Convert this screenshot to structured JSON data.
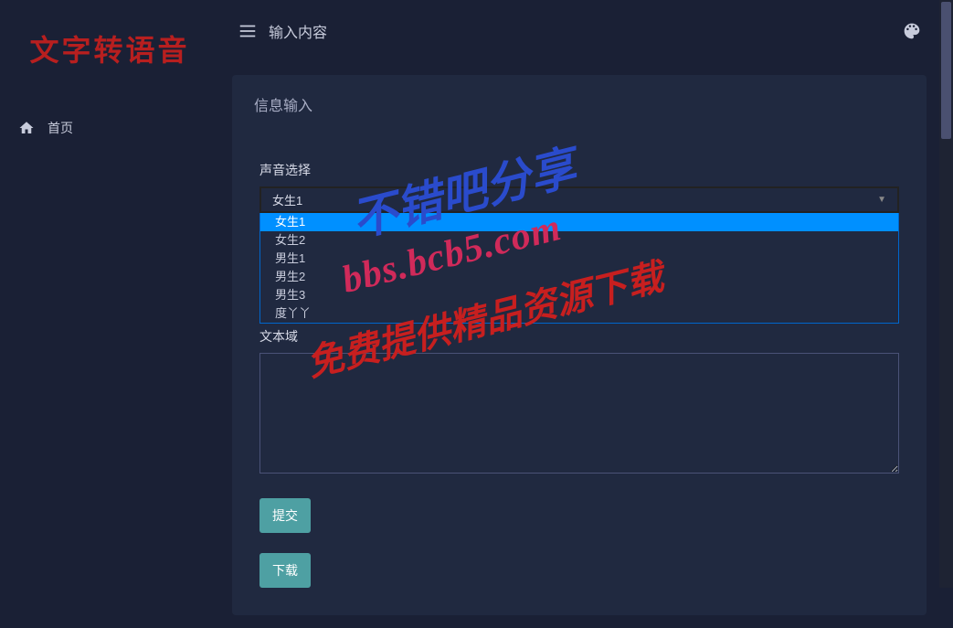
{
  "app": {
    "logo_text": "文字转语音"
  },
  "sidebar": {
    "items": [
      {
        "label": "首页",
        "icon": "home-icon"
      }
    ]
  },
  "header": {
    "title": "输入内容"
  },
  "card": {
    "header_title": "信息输入"
  },
  "form": {
    "voice_select": {
      "label": "声音选择",
      "selected": "女生1",
      "options": [
        "女生1",
        "女生2",
        "男生1",
        "男生2",
        "男生3",
        "度丫丫"
      ]
    },
    "textarea": {
      "label": "文本域",
      "value": ""
    },
    "submit_button": "提交",
    "download_button": "下载"
  },
  "watermark": {
    "line1": "不错吧分享",
    "line2": "bbs.bcb5.com",
    "line3": "免费提供精品资源下载"
  }
}
